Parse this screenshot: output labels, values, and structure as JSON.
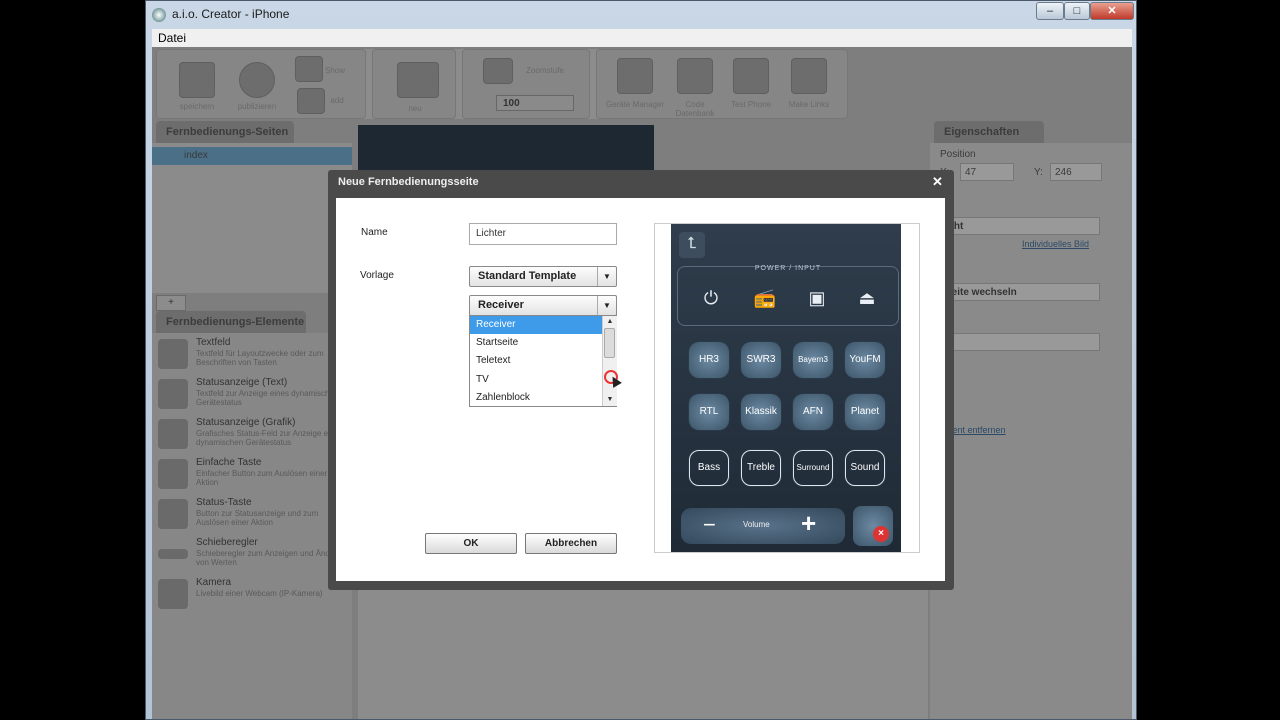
{
  "window": {
    "title": "a.i.o. Creator - iPhone",
    "min": "–",
    "max": "□",
    "close": "✕"
  },
  "menu": {
    "datei": "Datei"
  },
  "toolbar": {
    "save": "speichern",
    "publish": "publizieren",
    "show": "Show",
    "add": "add",
    "new": "neu",
    "zoom_label": "Zoomstufe",
    "zoom_value": "100",
    "device_manager": "Geräte Manager",
    "code_database": "Code Datenbank",
    "test_phone": "Test Phone",
    "make_links": "Make Links"
  },
  "left": {
    "pages_header": "Fernbedienungs-Seiten",
    "page_item": "index",
    "plus": "+",
    "elements_header": "Fernbedienungs-Elemente",
    "elements": [
      {
        "title": "Textfeld",
        "desc": "Textfeld für Layoutzwecke oder zum Beschriften von Tasten"
      },
      {
        "title": "Statusanzeige (Text)",
        "desc": "Textfeld zur Anzeige eines dynamischen Gerätestatus"
      },
      {
        "title": "Statusanzeige (Grafik)",
        "desc": "Grafisches Status-Feld zur Anzeige eines dynamischen Gerätestatus"
      },
      {
        "title": "Einfache Taste",
        "desc": "Einfacher Button zum Auslösen einer Aktion"
      },
      {
        "title": "Status-Taste",
        "desc": "Button zur Statusanzeige und zum Auslösen einer Aktion"
      },
      {
        "title": "Schieberegler",
        "desc": "Schieberegler zum Anzeigen und Ändern von Werten"
      },
      {
        "title": "Kamera",
        "desc": "Livebild einer Webcam (IP-Kamera)"
      }
    ]
  },
  "right": {
    "header": "Eigenschaften",
    "position": "Position",
    "x_label": "X:",
    "x_value": "47",
    "y_label": "Y:",
    "y_value": "246",
    "image_select": "ight",
    "individual_link": "Individuelles Bild",
    "action_select": "Seite wechseln",
    "remove_link": "ement entfernen"
  },
  "dialog": {
    "title": "Neue Fernbedienungsseite",
    "close": "✕",
    "name_label": "Name",
    "name_value": "Lichter",
    "template_label": "Vorlage",
    "template_value": "Standard Template",
    "sub_value": "Receiver",
    "options": [
      "Receiver",
      "Startseite",
      "Teletext",
      "TV",
      "Zahlenblock"
    ],
    "ok": "OK",
    "cancel": "Abbrechen"
  },
  "preview": {
    "power_label": "POWER / INPUT",
    "stations_row1": [
      "HR3",
      "SWR3",
      "Bayern3",
      "YouFM"
    ],
    "stations_row2": [
      "RTL",
      "Klassik",
      "AFN",
      "Planet"
    ],
    "sound_row": [
      "Bass",
      "Treble",
      "Surround",
      "Sound"
    ],
    "volume": "Volume",
    "minus": "−",
    "plus": "+"
  },
  "colors": {
    "selection": "#3d9be9",
    "phone_bg": "#2a3644"
  }
}
